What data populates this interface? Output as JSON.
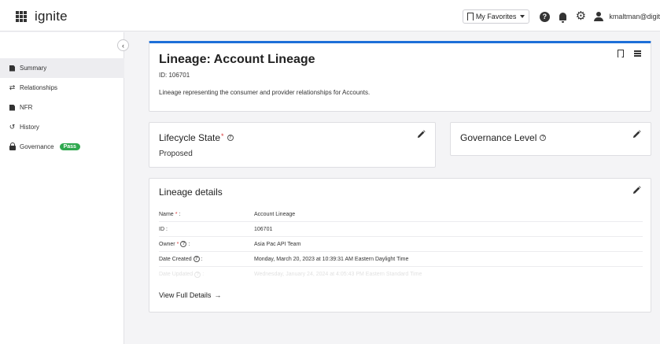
{
  "app": {
    "name": "ignite"
  },
  "topbar": {
    "favorites_label": "My Favorites",
    "user_name": "kmaltman@digit"
  },
  "sidebar": {
    "items": [
      {
        "label": "Summary",
        "icon": "document-icon",
        "active": true
      },
      {
        "label": "Relationships",
        "icon": "swap-arrows-icon"
      },
      {
        "label": "NFR",
        "icon": "document-icon"
      },
      {
        "label": "History",
        "icon": "history-icon"
      },
      {
        "label": "Governance",
        "icon": "lock-icon",
        "badge": "Pass"
      }
    ]
  },
  "main": {
    "title": "Lineage: Account Lineage",
    "id_line": "ID: 106701",
    "description": "Lineage representing the consumer and provider relationships for Accounts."
  },
  "lifecycle": {
    "title": "Lifecycle State",
    "required_mark": "*",
    "value": "Proposed"
  },
  "governance": {
    "title": "Governance Level"
  },
  "details": {
    "title": "Lineage details",
    "rows": [
      {
        "label": "Name",
        "required": "*",
        "suffix": " :",
        "value": "Account Lineage"
      },
      {
        "label": "ID :",
        "value": "106701"
      },
      {
        "label": "Owner",
        "required": "*",
        "suffix": " :",
        "value": "Asia Pac API Team"
      },
      {
        "label": "Date Created",
        "suffix": " :",
        "value": "Monday, March 20, 2023 at 10:39:31 AM Eastern Daylight Time"
      },
      {
        "label": "Date Updated",
        "suffix": " :",
        "value": "Wednesday, January 24, 2024 at 4:05:43 PM Eastern Standard Time"
      }
    ],
    "view_full": "View Full Details"
  },
  "colors": {
    "accent": "#1d6fd8",
    "pass": "#2fa84f",
    "required": "#d83a3a"
  }
}
